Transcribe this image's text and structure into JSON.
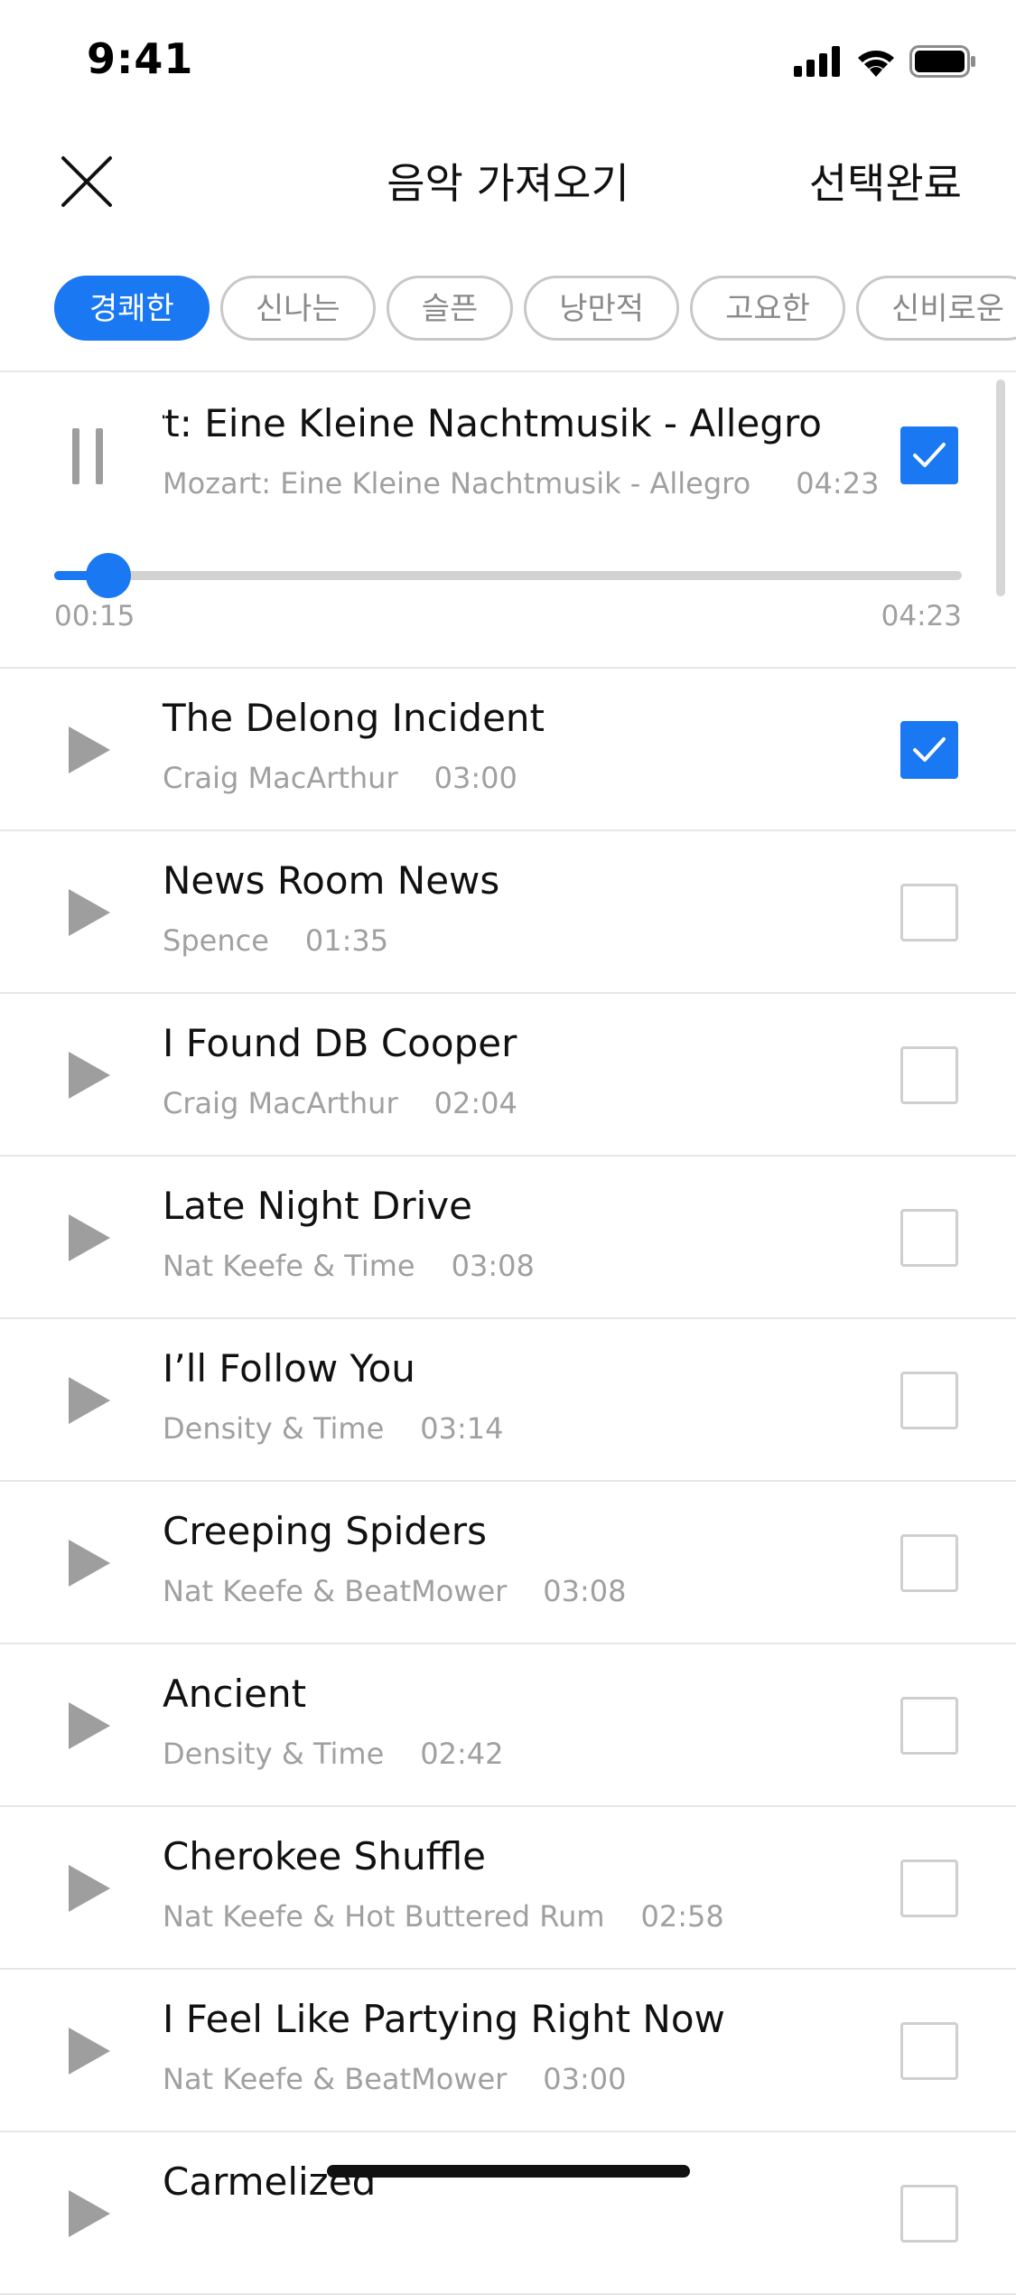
{
  "status_bar": {
    "time": "9:41",
    "icons": [
      "cellular-signal-icon",
      "wifi-icon",
      "battery-icon"
    ]
  },
  "header": {
    "close_icon": "close-icon",
    "title": "음악 가져오기",
    "done_label": "선택완료"
  },
  "moods": [
    {
      "label": "경쾌한",
      "active": true
    },
    {
      "label": "신나는",
      "active": false
    },
    {
      "label": "슬픈",
      "active": false
    },
    {
      "label": "낭만적",
      "active": false
    },
    {
      "label": "고요한",
      "active": false
    },
    {
      "label": "신비로운",
      "active": false
    }
  ],
  "now_playing": {
    "title": "Mozart: Eine Kleine Nachtmusik - Allegro",
    "subtitle": "Mozart: Eine Kleine Nachtmusik - Allegro",
    "duration": "04:23",
    "current_time": "00:15",
    "total_time": "04:23",
    "progress_fraction": 0.06,
    "checked": true,
    "control_icon": "pause-icon"
  },
  "tracks": [
    {
      "title": "The Delong Incident",
      "artist": "Craig MacArthur",
      "duration": "03:00",
      "checked": true
    },
    {
      "title": "News Room News",
      "artist": "Spence",
      "duration": "01:35",
      "checked": false
    },
    {
      "title": "I Found DB Cooper",
      "artist": "Craig MacArthur",
      "duration": "02:04",
      "checked": false
    },
    {
      "title": "Late Night Drive",
      "artist": "Nat Keefe & Time",
      "duration": "03:08",
      "checked": false
    },
    {
      "title": "I’ll Follow You",
      "artist": "Density & Time",
      "duration": "03:14",
      "checked": false
    },
    {
      "title": "Creeping Spiders",
      "artist": "Nat Keefe & BeatMower",
      "duration": "03:08",
      "checked": false
    },
    {
      "title": "Ancient",
      "artist": "Density & Time",
      "duration": "02:42",
      "checked": false
    },
    {
      "title": "Cherokee Shuffle",
      "artist": "Nat Keefe & Hot Buttered Rum",
      "duration": "02:58",
      "checked": false
    },
    {
      "title": "I Feel Like Partying Right Now",
      "artist": "Nat Keefe & BeatMower",
      "duration": "03:00",
      "checked": false
    },
    {
      "title": "Carmelized",
      "artist": "",
      "duration": "",
      "checked": false
    }
  ],
  "colors": {
    "accent": "#1a78f2",
    "text_primary": "#111111",
    "text_secondary": "#a0a0a0",
    "chip_border": "#c8c8c8",
    "divider": "#e6e6e6",
    "icon_gray": "#9e9e9e"
  }
}
